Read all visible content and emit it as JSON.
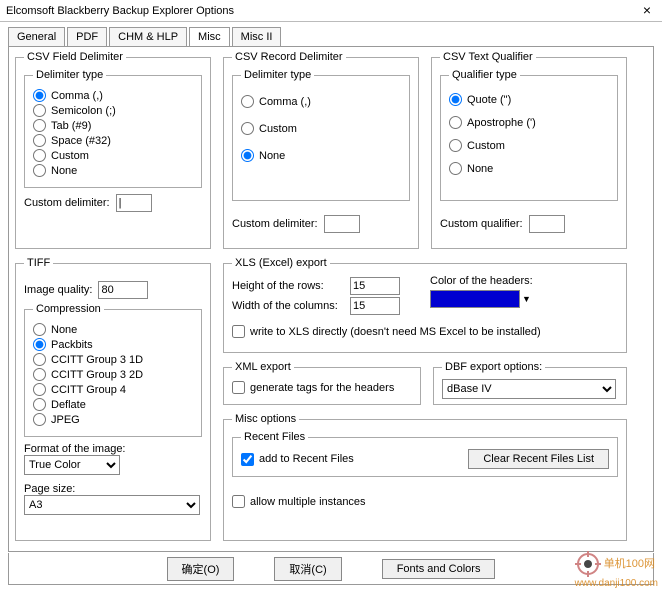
{
  "window": {
    "title": "Elcomsoft Blackberry Backup Explorer Options",
    "close": "×"
  },
  "tabs": [
    "General",
    "PDF",
    "CHM & HLP",
    "Misc",
    "Misc II"
  ],
  "activeTab": 3,
  "csvField": {
    "legend": "CSV Field Delimiter",
    "typeLegend": "Delimiter type",
    "options": [
      "Comma (,)",
      "Semicolon (;)",
      "Tab (#9)",
      "Space (#32)",
      "Custom",
      "None"
    ],
    "selected": 0,
    "customLabel": "Custom delimiter:",
    "customValue": "|"
  },
  "csvRecord": {
    "legend": "CSV Record Delimiter",
    "typeLegend": "Delimiter type",
    "options": [
      "Comma (,)",
      "Custom",
      "None"
    ],
    "selected": 2,
    "customLabel": "Custom delimiter:",
    "customValue": ""
  },
  "csvQual": {
    "legend": "CSV Text Qualifier",
    "typeLegend": "Qualifier type",
    "options": [
      "Quote (\")",
      "Apostrophe (')",
      "Custom",
      "None"
    ],
    "selected": 0,
    "customLabel": "Custom qualifier:",
    "customValue": ""
  },
  "tiff": {
    "legend": "TIFF",
    "qualityLabel": "Image quality:",
    "quality": "80",
    "compLegend": "Compression",
    "compOptions": [
      "None",
      "Packbits",
      "CCITT Group 3 1D",
      "CCITT Group 3 2D",
      "CCITT Group 4",
      "Deflate",
      "JPEG"
    ],
    "compSelected": 1,
    "formatLabel": "Format of the image:",
    "formatValue": "True Color",
    "pageLabel": "Page size:",
    "pageValue": "A3"
  },
  "xls": {
    "legend": "XLS (Excel) export",
    "rowH": "Height of the rows:",
    "rowHVal": "15",
    "colW": "Width of the columns:",
    "colWVal": "15",
    "headerColor": "Color of the headers:",
    "headerColorVal": "#0000d0",
    "directChk": "write to XLS directly (doesn't need MS Excel to be installed)"
  },
  "xml": {
    "legend": "XML export",
    "genTags": "generate tags for the headers"
  },
  "dbf": {
    "legend": "DBF export options:",
    "value": "dBase IV"
  },
  "miscOpt": {
    "legend": "Misc options",
    "recentLegend": "Recent Files",
    "addRecent": "add to Recent Files",
    "clearBtn": "Clear Recent Files List",
    "allowMulti": "allow multiple instances"
  },
  "buttons": {
    "ok": "确定(O)",
    "cancel": "取消(C)",
    "colors": "Fonts and Colors"
  },
  "watermark": {
    "brand": "单机100网",
    "url": "www.danji100.com"
  }
}
